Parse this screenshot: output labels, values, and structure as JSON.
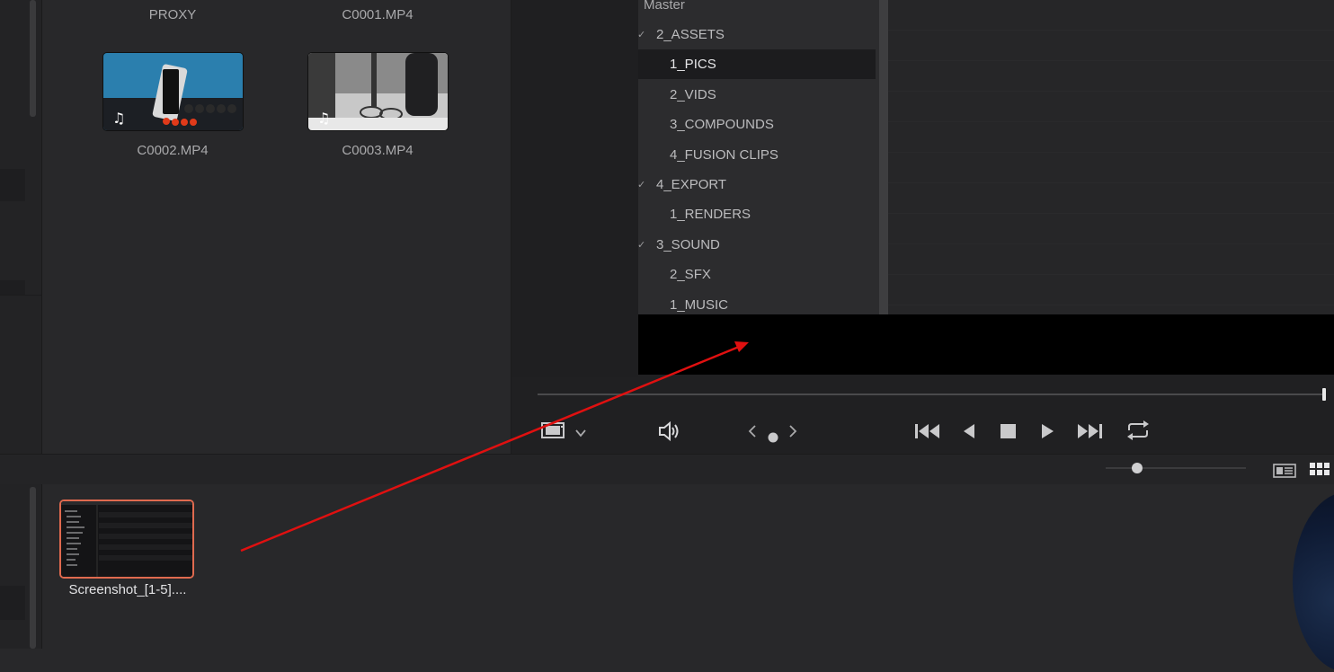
{
  "media_pool": {
    "top_labels": [
      "PROXY",
      "C0001.MP4"
    ],
    "clips": [
      {
        "name": "C0002.MP4"
      },
      {
        "name": "C0003.MP4"
      }
    ]
  },
  "bin_tree": {
    "root": "Master",
    "items": [
      {
        "label": "2_ASSETS",
        "checked": true,
        "selected": false
      },
      {
        "label": "1_PICS",
        "checked": false,
        "selected": true
      },
      {
        "label": "2_VIDS",
        "checked": false,
        "selected": false
      },
      {
        "label": "3_COMPOUNDS",
        "checked": false,
        "selected": false
      },
      {
        "label": "4_FUSION CLIPS",
        "checked": false,
        "selected": false
      },
      {
        "label": "4_EXPORT",
        "checked": true,
        "selected": false
      },
      {
        "label": "1_RENDERS",
        "checked": false,
        "selected": false
      },
      {
        "label": "3_SOUND",
        "checked": true,
        "selected": false
      },
      {
        "label": "2_SFX",
        "checked": false,
        "selected": false
      },
      {
        "label": "1_MUSIC",
        "checked": false,
        "selected": false
      }
    ],
    "check_glyph": "✓"
  },
  "transport": {
    "icons": [
      "clip-view-icon",
      "chevron-down-icon",
      "volume-icon",
      "prev-marker-icon",
      "marker-dot-icon",
      "next-marker-icon",
      "go-to-start-icon",
      "play-reverse-icon",
      "stop-icon",
      "play-icon",
      "go-to-end-icon",
      "loop-icon"
    ]
  },
  "bottom": {
    "selected_clip_name": "Screenshot_[1-5]....",
    "view_icons": [
      "list-view-icon",
      "grid-view-icon"
    ]
  },
  "colors": {
    "selection_border": "#e06a4f",
    "annotation_arrow": "#e01010"
  }
}
